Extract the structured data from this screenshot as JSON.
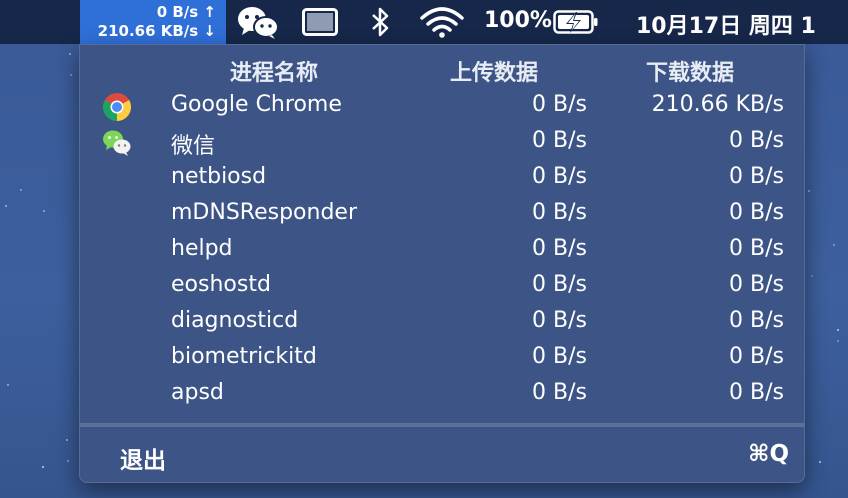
{
  "menubar": {
    "netspeed": {
      "upload": "0 B/s ↑",
      "download": "210.66 KB/s ↓"
    },
    "icons": [
      "wechat-icon",
      "display-icon",
      "bluetooth-icon",
      "wifi-icon"
    ],
    "battery": {
      "percent_text": "100%",
      "icon": "battery-charging-icon"
    },
    "clock": "10月17日 周四 1"
  },
  "panel": {
    "headers": {
      "name": "进程名称",
      "upload": "上传数据",
      "download": "下载数据"
    },
    "rows": [
      {
        "icon": "chrome-icon",
        "name": "Google Chrome",
        "upload": "0 B/s",
        "download": "210.66 KB/s"
      },
      {
        "icon": "wechat-icon",
        "name": "微信",
        "upload": "0 B/s",
        "download": "0 B/s"
      },
      {
        "icon": "",
        "name": "netbiosd",
        "upload": "0 B/s",
        "download": "0 B/s"
      },
      {
        "icon": "",
        "name": "mDNSResponder",
        "upload": "0 B/s",
        "download": "0 B/s"
      },
      {
        "icon": "",
        "name": "helpd",
        "upload": "0 B/s",
        "download": "0 B/s"
      },
      {
        "icon": "",
        "name": "eoshostd",
        "upload": "0 B/s",
        "download": "0 B/s"
      },
      {
        "icon": "",
        "name": "diagnosticd",
        "upload": "0 B/s",
        "download": "0 B/s"
      },
      {
        "icon": "",
        "name": "biometrickitd",
        "upload": "0 B/s",
        "download": "0 B/s"
      },
      {
        "icon": "",
        "name": "apsd",
        "upload": "0 B/s",
        "download": "0 B/s"
      }
    ],
    "quit_label": "退出",
    "quit_shortcut": "⌘Q"
  },
  "colors": {
    "menubar_bg": "#16274a",
    "netspeed_highlight": "#2f6fd8",
    "panel_bg": "#3d5586",
    "separator": "#5b719c"
  }
}
